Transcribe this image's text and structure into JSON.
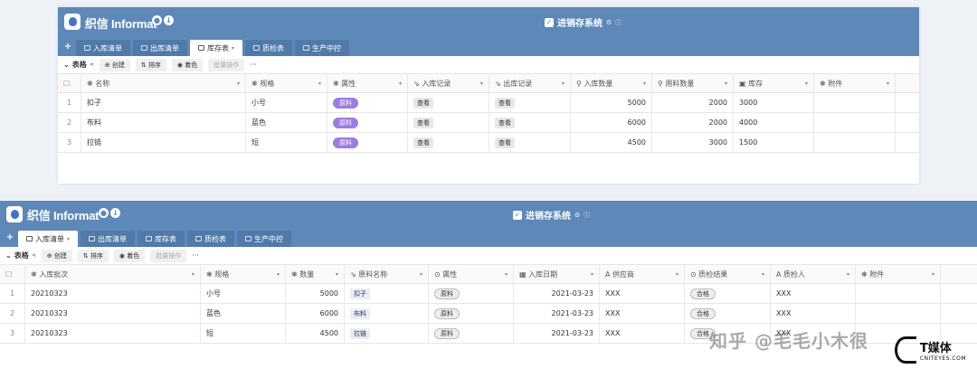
{
  "app": {
    "name": "织信 Informat",
    "system": "进销存系统",
    "settings_icon": "gear-icon",
    "info_icon": "info-icon"
  },
  "p1": {
    "tabs": [
      "入库清单",
      "出库清单",
      "库存表",
      "质检表",
      "生产中控"
    ],
    "active_tab_index": 2,
    "toolbar": {
      "view": "表格",
      "create": "创建",
      "sort": "排序",
      "color": "着色",
      "batch": "批量操作",
      "more": "···"
    },
    "headers": [
      "名称",
      "规格",
      "属性",
      "入库记录",
      "出库记录",
      "入库数量",
      "用料数量",
      "库存",
      "附件"
    ],
    "rows": [
      {
        "no": "1",
        "name": "扣子",
        "spec": "小号",
        "attr": "原料",
        "in": "查看",
        "out": "查看",
        "in_qty": "5000",
        "use_qty": "2000",
        "stock": "3000"
      },
      {
        "no": "2",
        "name": "布料",
        "spec": "蓝色",
        "attr": "原料",
        "in": "查看",
        "out": "查看",
        "in_qty": "6000",
        "use_qty": "2000",
        "stock": "4000"
      },
      {
        "no": "3",
        "name": "拉链",
        "spec": "短",
        "attr": "原料",
        "in": "查看",
        "out": "查看",
        "in_qty": "4500",
        "use_qty": "3000",
        "stock": "1500"
      }
    ]
  },
  "p2": {
    "tabs": [
      "入库清单",
      "出库清单",
      "库存表",
      "质检表",
      "生产中控"
    ],
    "active_tab_index": 0,
    "toolbar": {
      "view": "表格",
      "create": "创建",
      "sort": "排序",
      "color": "着色",
      "batch": "批量操作",
      "more": "···"
    },
    "headers": [
      "入库批次",
      "规格",
      "数量",
      "原料名称",
      "属性",
      "入库日期",
      "供应商",
      "质检结果",
      "质检人",
      "附件"
    ],
    "rows": [
      {
        "no": "1",
        "batch": "20210323",
        "spec": "小号",
        "qty": "5000",
        "mat": "扣子",
        "attr": "原料",
        "date": "2021-03-23",
        "supplier": "XXX",
        "result": "合格",
        "inspector": "XXX"
      },
      {
        "no": "2",
        "batch": "20210323",
        "spec": "蓝色",
        "qty": "6000",
        "mat": "布料",
        "attr": "原料",
        "date": "2021-03-23",
        "supplier": "XXX",
        "result": "合格",
        "inspector": "XXX"
      },
      {
        "no": "3",
        "batch": "20210323",
        "spec": "短",
        "qty": "4500",
        "mat": "拉链",
        "attr": "原料",
        "date": "2021-03-23",
        "supplier": "XXX",
        "result": "合格",
        "inspector": "XXX"
      }
    ]
  },
  "watermark": {
    "zhihu": "知乎 @毛毛小木很",
    "brand_big": "T媒体",
    "brand_small": "CNITEYES.COM"
  },
  "colors": {
    "header": "#5d88b8",
    "tag": "#9c7de1"
  }
}
